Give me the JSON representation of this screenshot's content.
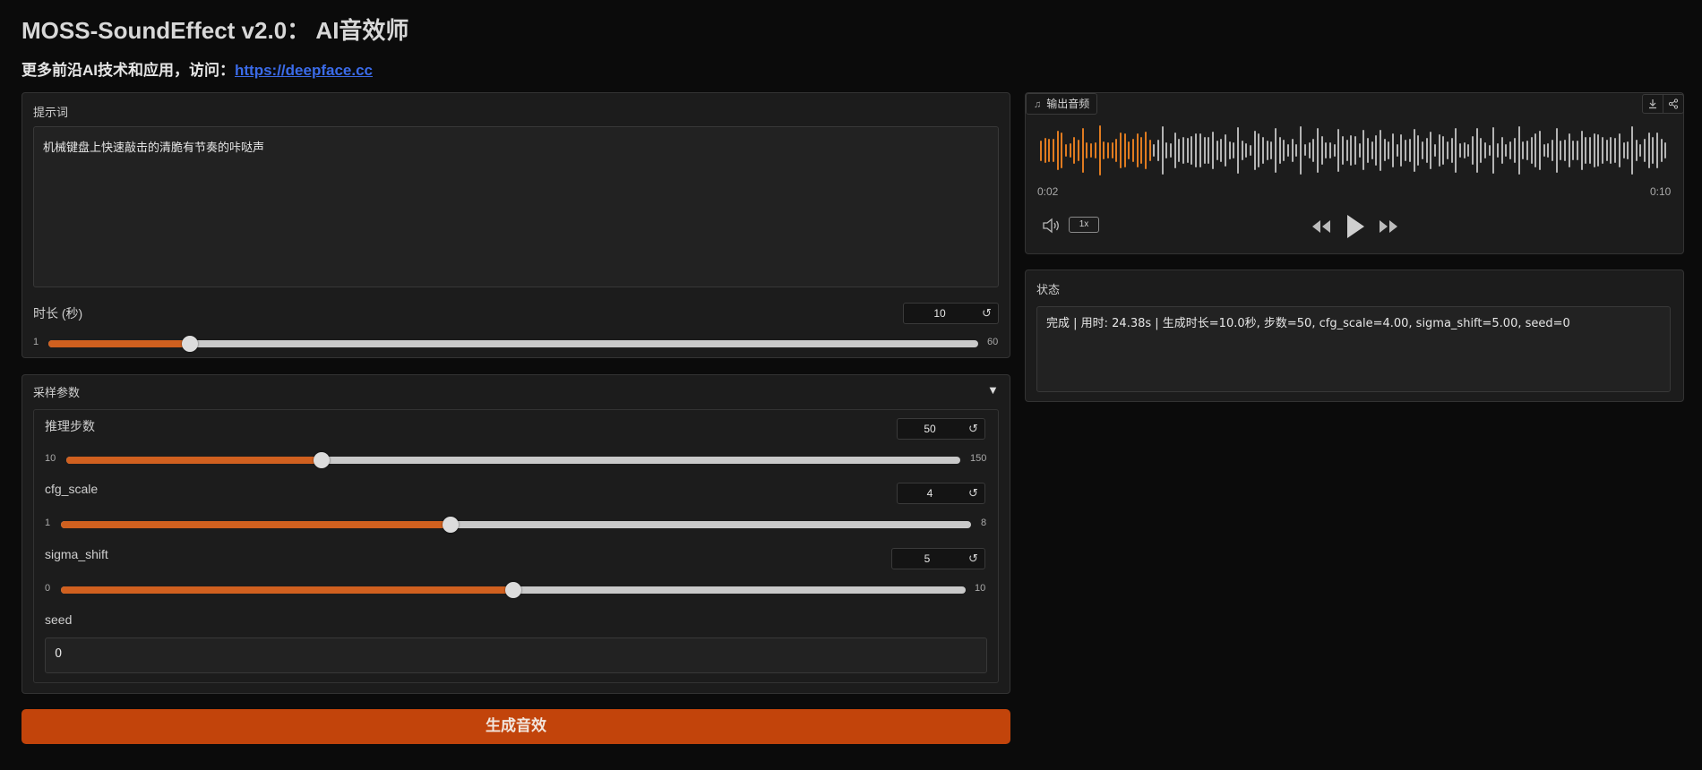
{
  "app": {
    "title": "MOSS-SoundEffect v2.0： AI音效师",
    "subtitle_prefix": "更多前沿AI技术和应用，访问：",
    "subtitle_link": "https://deepface.cc"
  },
  "prompt": {
    "label": "提示词",
    "value": "机械键盘上快速敲击的清脆有节奏的咔哒声"
  },
  "duration": {
    "label": "时长 (秒)",
    "value": "10",
    "min": "1",
    "max": "60",
    "fraction": 0.1525
  },
  "sampling": {
    "label": "采样参数",
    "collapse_icon": "triangle-down-icon",
    "steps": {
      "label": "推理步数",
      "value": "50",
      "min": "10",
      "max": "150",
      "fraction": 0.2857
    },
    "cfg_scale": {
      "label": "cfg_scale",
      "value": "4",
      "min": "1",
      "max": "8",
      "fraction": 0.4286
    },
    "sigma_shift": {
      "label": "sigma_shift",
      "value": "5",
      "min": "0",
      "max": "10",
      "fraction": 0.5
    },
    "seed": {
      "label": "seed",
      "value": "0"
    }
  },
  "generate_button": "生成音效",
  "audio": {
    "label": "输出音频",
    "current_time": "0:02",
    "total_time": "0:10",
    "progress_fraction": 0.18,
    "playback_rate": "1x",
    "played_color": "#e07b20",
    "unplayed_color": "#b4b4b4"
  },
  "status": {
    "label": "状态",
    "text": "完成 | 用时: 24.38s | 生成时长=10.0秒, 步数=50, cfg_scale=4.00, sigma_shift=5.00, seed=0"
  },
  "colors": {
    "accent": "#d0601f",
    "button": "#c2440b",
    "link": "#3b6be8"
  }
}
